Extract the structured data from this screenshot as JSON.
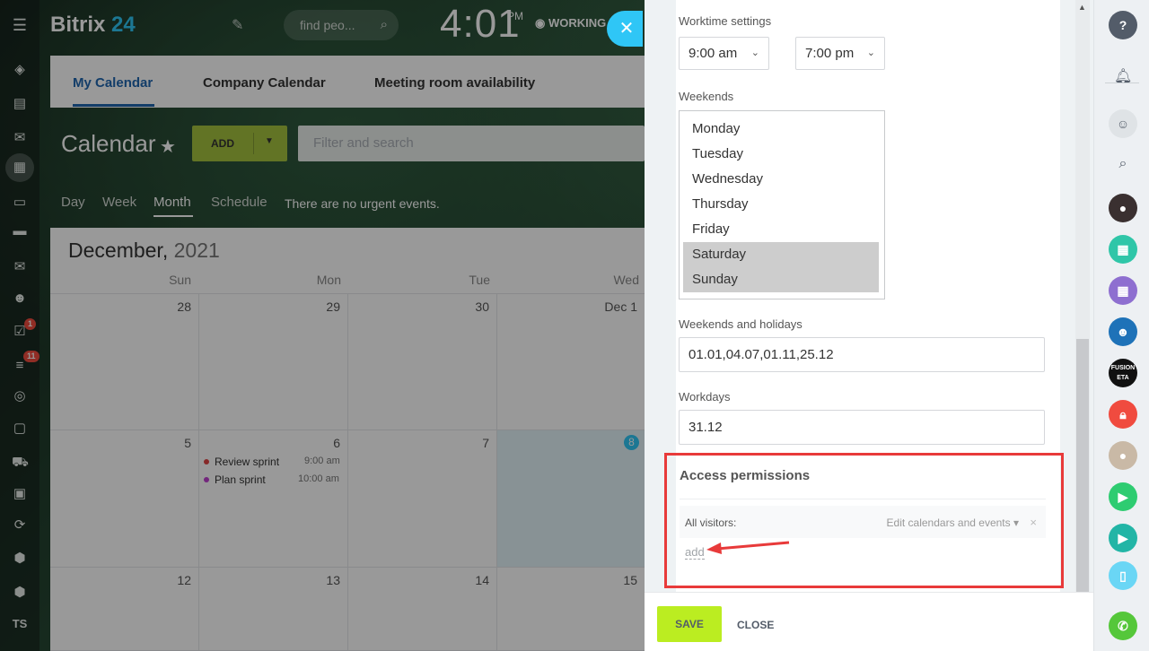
{
  "header": {
    "logo_text": "Bitrix",
    "logo_num": "24",
    "search_placeholder": "find peo...",
    "time": "4:01",
    "ampm": "PM",
    "status": "WORKING"
  },
  "tabs": [
    "My Calendar",
    "Company Calendar",
    "Meeting room availability"
  ],
  "calendar": {
    "title": "Calendar",
    "add_label": "ADD",
    "filter_placeholder": "Filter and search",
    "views": [
      "Day",
      "Week",
      "Month",
      "Schedule"
    ],
    "urgent_text": "There are no urgent events.",
    "month": "December,",
    "year": "2021",
    "days_of_week": [
      "Sun",
      "Mon",
      "Tue",
      "Wed"
    ],
    "rows": [
      [
        "28",
        "29",
        "30",
        "Dec 1"
      ],
      [
        "5",
        "6",
        "7",
        "8"
      ],
      [
        "12",
        "13",
        "14",
        "15"
      ]
    ],
    "events": [
      {
        "title": "Review sprint",
        "time": "9:00 am",
        "color": "#e04545"
      },
      {
        "title": "Plan sprint",
        "time": "10:00 am",
        "color": "#c040d0"
      }
    ]
  },
  "left_sidebar": {
    "badges": [
      "1",
      "11"
    ],
    "initials": "TS"
  },
  "settings": {
    "worktime_label": "Worktime settings",
    "start_time": "9:00 am",
    "end_time": "7:00 pm",
    "weekends_label": "Weekends",
    "weekdays": [
      "Monday",
      "Tuesday",
      "Wednesday",
      "Thursday",
      "Friday",
      "Saturday",
      "Sunday"
    ],
    "selected_weekends": [
      "Saturday",
      "Sunday"
    ],
    "holidays_label": "Weekends and holidays",
    "holidays_value": "01.01,04.07,01.11,25.12",
    "workdays_label": "Workdays",
    "workdays_value": "31.12"
  },
  "access": {
    "title": "Access permissions",
    "who": "All visitors:",
    "permission": "Edit calendars and events",
    "add_link": "add"
  },
  "footer": {
    "save": "SAVE",
    "close": "CLOSE"
  },
  "right_bar": {
    "avatar_text": "FUSION ETA"
  },
  "colors": {
    "accent_blue": "#2fc6f6",
    "save_green": "#bbed21",
    "highlight_red": "#e83a3a"
  }
}
